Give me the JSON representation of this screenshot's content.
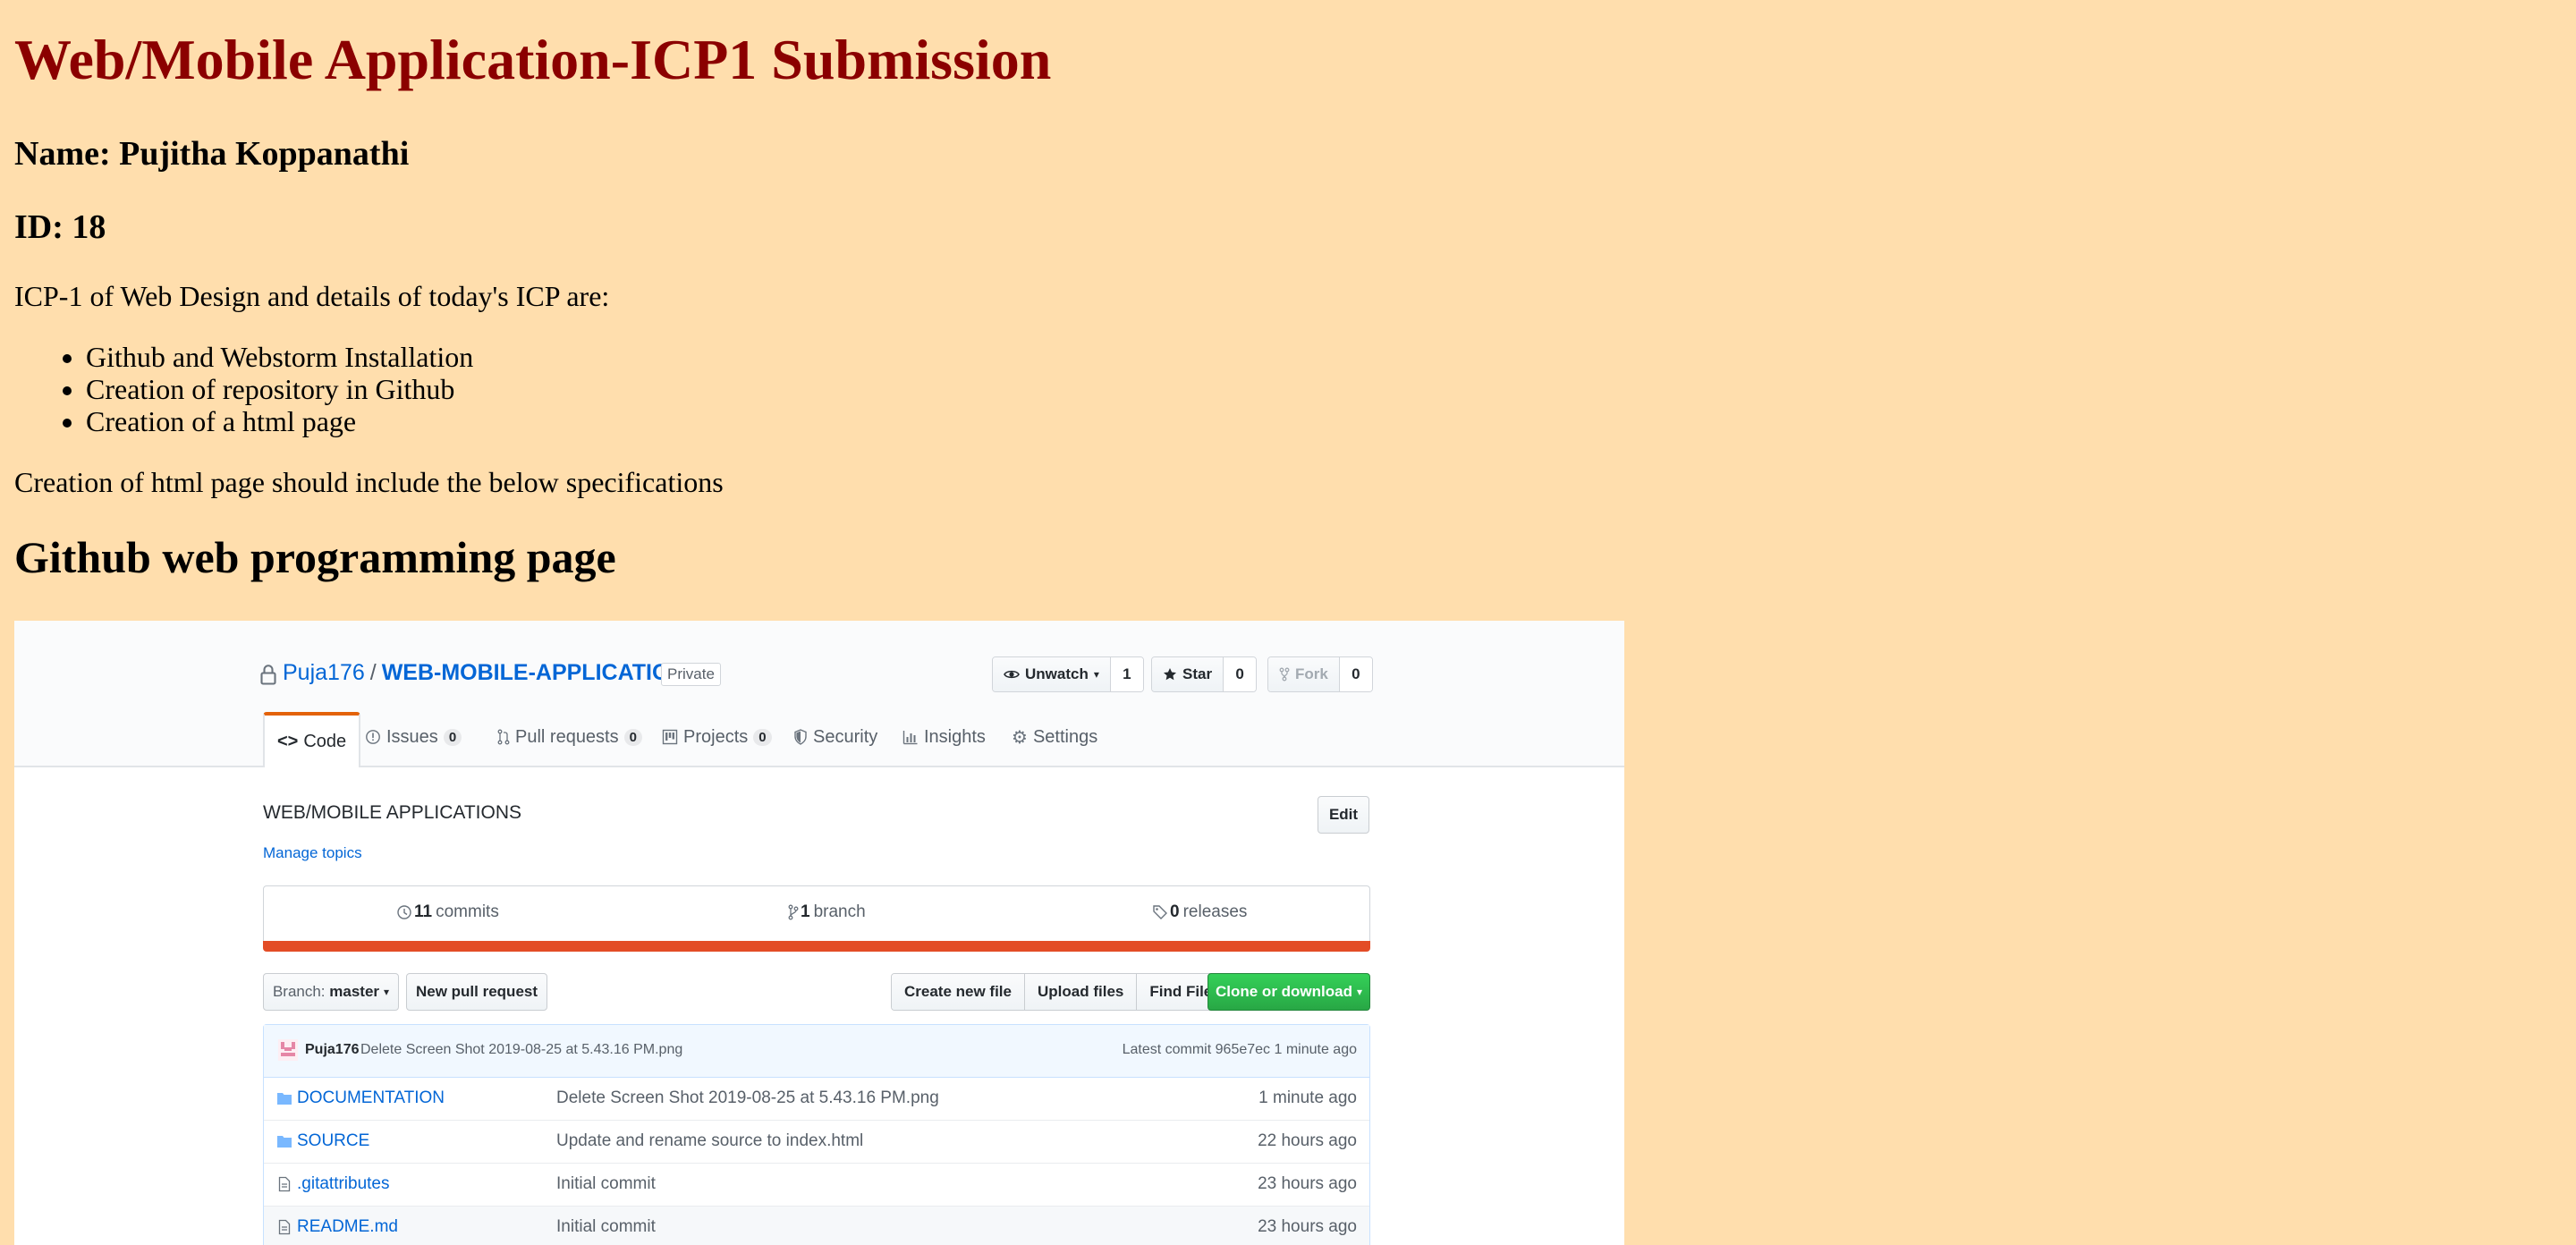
{
  "page": {
    "title": "Web/Mobile Application-ICP1 Submission",
    "name_line": "Name: Pujitha Koppanathi",
    "id_line": "ID: 18",
    "intro": "ICP-1 of Web Design and details of today's ICP are:",
    "list": [
      "Github and Webstorm Installation",
      "Creation of repository in Github",
      "Creation of a html page"
    ],
    "spec": "Creation of html page should include the below specifications",
    "github_heading": "Github web programming page"
  },
  "github": {
    "owner": "Puja176",
    "separator": "/",
    "repo": "WEB-MOBILE-APPLICATIONS",
    "visibility": "Private",
    "actions": {
      "watch": {
        "label": "Unwatch",
        "count": "1"
      },
      "star": {
        "label": "Star",
        "count": "0"
      },
      "fork": {
        "label": "Fork",
        "count": "0"
      }
    },
    "tabs": [
      {
        "label": "Code",
        "count": null,
        "icon": "code-icon"
      },
      {
        "label": "Issues",
        "count": "0",
        "icon": "issue-icon"
      },
      {
        "label": "Pull requests",
        "count": "0",
        "icon": "pull-request-icon"
      },
      {
        "label": "Projects",
        "count": "0",
        "icon": "project-icon"
      },
      {
        "label": "Security",
        "count": null,
        "icon": "shield-icon"
      },
      {
        "label": "Insights",
        "count": null,
        "icon": "graph-icon"
      },
      {
        "label": "Settings",
        "count": null,
        "icon": "gear-icon"
      }
    ],
    "description": "WEB/MOBILE APPLICATIONS",
    "edit_label": "Edit",
    "manage_topics": "Manage topics",
    "summary": {
      "commits": {
        "count": "11",
        "label": "commits"
      },
      "branches": {
        "count": "1",
        "label": "branch"
      },
      "releases": {
        "count": "0",
        "label": "releases"
      }
    },
    "language_color": "#e34c26",
    "branch_label": "Branch:",
    "branch_name": "master",
    "new_pull_request": "New pull request",
    "file_buttons": [
      "Create new file",
      "Upload files",
      "Find File"
    ],
    "clone_label": "Clone or download",
    "latest_commit": {
      "author": "Puja176",
      "message": "Delete Screen Shot 2019-08-25 at 5.43.16 PM.png",
      "latest_label": "Latest commit",
      "sha": "965e7ec",
      "age": "1 minute ago"
    },
    "files": [
      {
        "type": "folder",
        "name": "DOCUMENTATION",
        "message": "Delete Screen Shot 2019-08-25 at 5.43.16 PM.png",
        "age": "1 minute ago"
      },
      {
        "type": "folder",
        "name": "SOURCE",
        "message": "Update and rename source to index.html",
        "age": "22 hours ago"
      },
      {
        "type": "file",
        "name": ".gitattributes",
        "message": "Initial commit",
        "age": "23 hours ago"
      },
      {
        "type": "file",
        "name": "README.md",
        "message": "Initial commit",
        "age": "23 hours ago"
      }
    ]
  },
  "colors": {
    "page_background": "#ffdead",
    "title_color": "#8b0000",
    "link_blue": "#0366d6",
    "active_tab_accent": "#e36209",
    "clone_green": "#28a745"
  }
}
